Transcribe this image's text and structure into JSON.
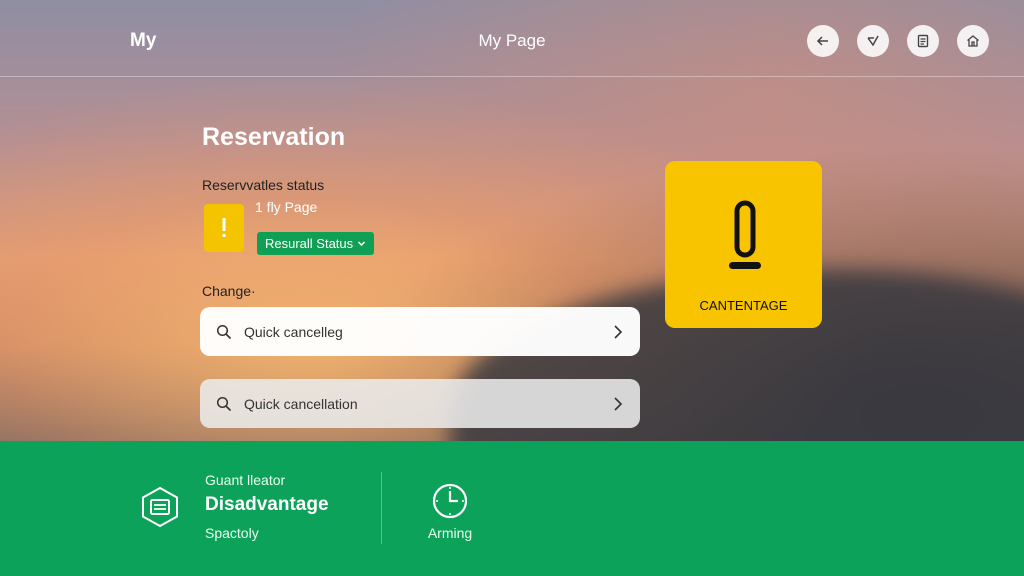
{
  "header": {
    "brand": "My",
    "title": "My Page",
    "actions": [
      {
        "icon": "back-arrow-icon"
      },
      {
        "icon": "check-icon"
      },
      {
        "icon": "document-icon"
      },
      {
        "icon": "home-icon"
      }
    ]
  },
  "main": {
    "heading": "Reservation",
    "status_label": "Reservvatles status",
    "page_sub": "1 fly Page",
    "status_pill": "Resurall Status",
    "change_label": "Change·",
    "search_rows": [
      {
        "text": "Quick cancelleg",
        "icon": "search-icon"
      },
      {
        "text": "Quick cancellation",
        "icon": "search-icon"
      }
    ]
  },
  "tile": {
    "label": "CANTENTAGE",
    "icon": "exclamation-icon",
    "color": "#f8c400"
  },
  "bottom": {
    "subtitle": "Guant lleator",
    "title": "Disadvantage",
    "note": "Spactoly",
    "clock_label": "Arming",
    "color": "#0da25a"
  }
}
